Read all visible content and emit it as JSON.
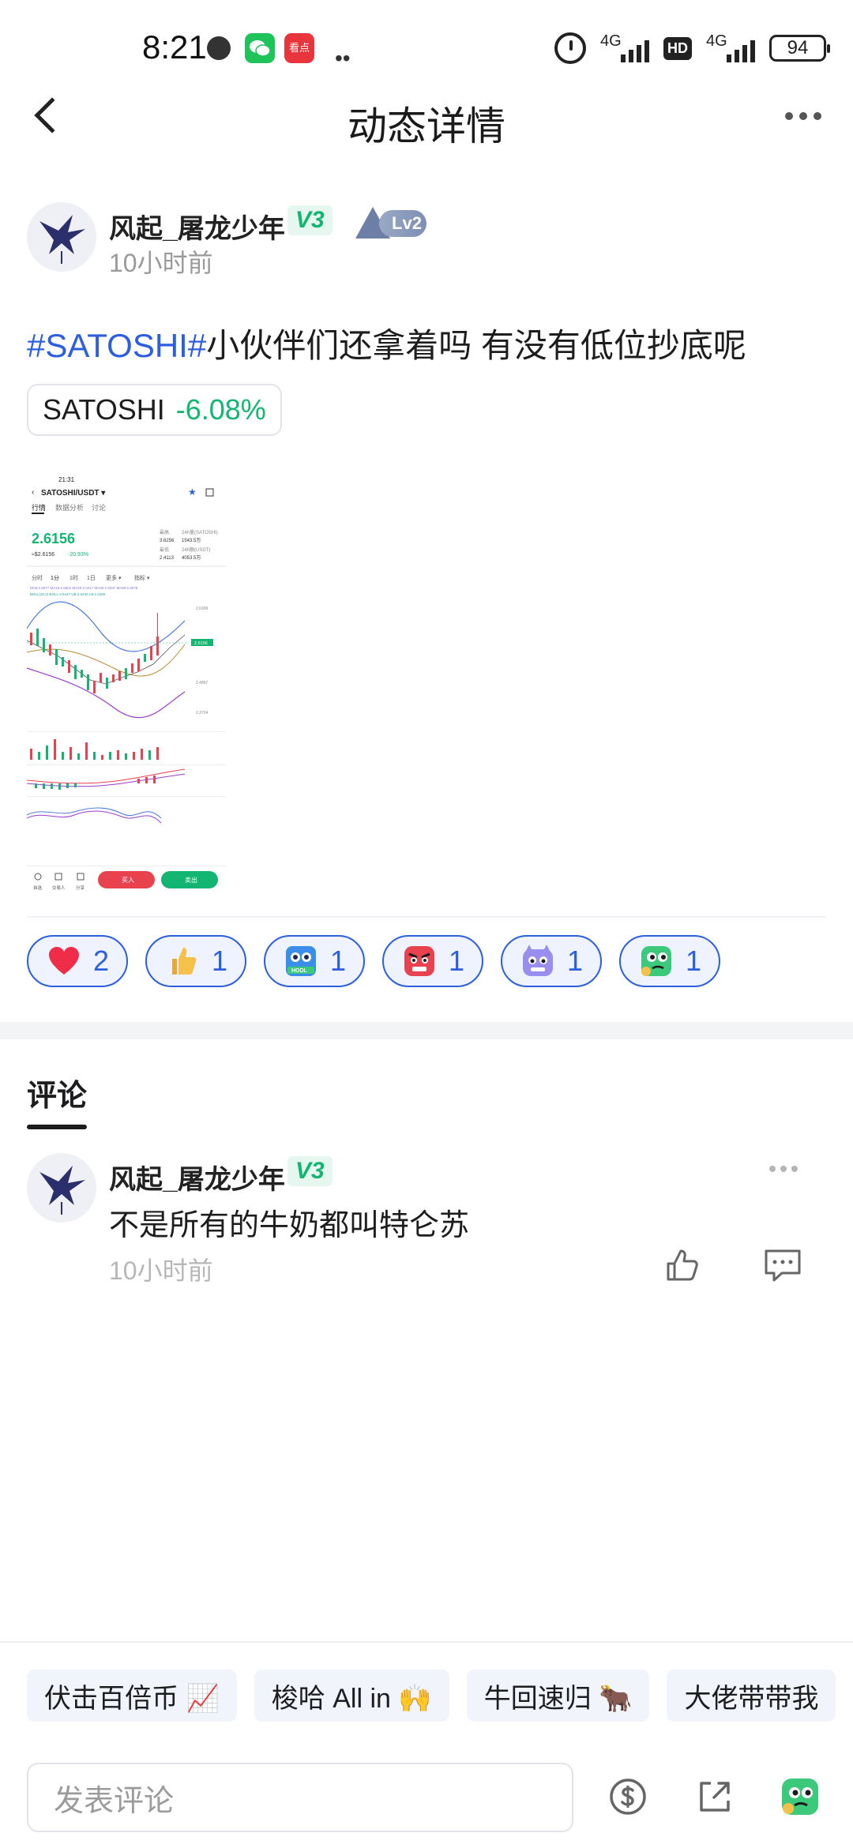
{
  "status_bar": {
    "time": "8:21",
    "app_badge_text": "看点",
    "network_1": "4G",
    "network_2": "4G",
    "hd": "HD",
    "battery": "94"
  },
  "header": {
    "title": "动态详情"
  },
  "post": {
    "author": "风起_屠龙少年",
    "vip_badge": "V3",
    "level_badge": "Lv2",
    "time": "10小时前",
    "hashtag": "#SATOSHI#",
    "text": "小伙伴们还拿着吗  有没有低位抄底呢",
    "coin": {
      "symbol": "SATOSHI",
      "change": "-6.08%"
    },
    "screenshot": {
      "status_time": "21:31",
      "pair": "SATOSHI/USDT ▾",
      "tabs": [
        "行情",
        "数据分析",
        "讨论"
      ],
      "price": "2.6156",
      "price_sub": "≈$2.6156",
      "change": "-20.93%",
      "stats": [
        "最高",
        "24h量(SATOSHI)",
        "3.6256",
        "1543.5万",
        "最低",
        "24h额(USDT)",
        "2.4113",
        "4053.5万"
      ],
      "intervals": [
        "分时",
        "1分",
        "1时",
        "1日",
        "更多 ▾",
        "指标 ▾"
      ],
      "ma_line": "MA5:2.5877  MA10:2.5601  MA20:2.5417  MA30:2.5437  MA60:2.5578",
      "boll_line": "BOLL(20,2)  BOLL:2.5447  UB:2.6430  LB:2.4405",
      "axis": [
        "2.6309",
        "2.6156",
        "2.5296",
        "2.4867",
        "2.3724"
      ],
      "buy": "买入",
      "sell": "卖出",
      "nav": [
        "自选",
        "交易人",
        "分享"
      ]
    },
    "reactions": [
      {
        "icon": "heart",
        "count": "2"
      },
      {
        "icon": "thumbs-up",
        "count": "1"
      },
      {
        "icon": "hodl-robot",
        "count": "1"
      },
      {
        "icon": "angry-face",
        "count": "1"
      },
      {
        "icon": "purple-monster",
        "count": "1"
      },
      {
        "icon": "green-thinking",
        "count": "1"
      }
    ]
  },
  "comments": {
    "tab_label": "评论",
    "items": [
      {
        "author": "风起_屠龙少年",
        "vip_badge": "V3",
        "text": "不是所有的牛奶都叫特仑苏",
        "time": "10小时前"
      }
    ]
  },
  "quick_replies": [
    "伏击百倍币 📈",
    "梭哈 All in 🙌",
    "牛回速归 🐂",
    "大佬带带我"
  ],
  "composer": {
    "placeholder": "发表评论"
  },
  "colors": {
    "accent_blue": "#2c5fe0",
    "green": "#12b571",
    "red": "#e8424f"
  }
}
